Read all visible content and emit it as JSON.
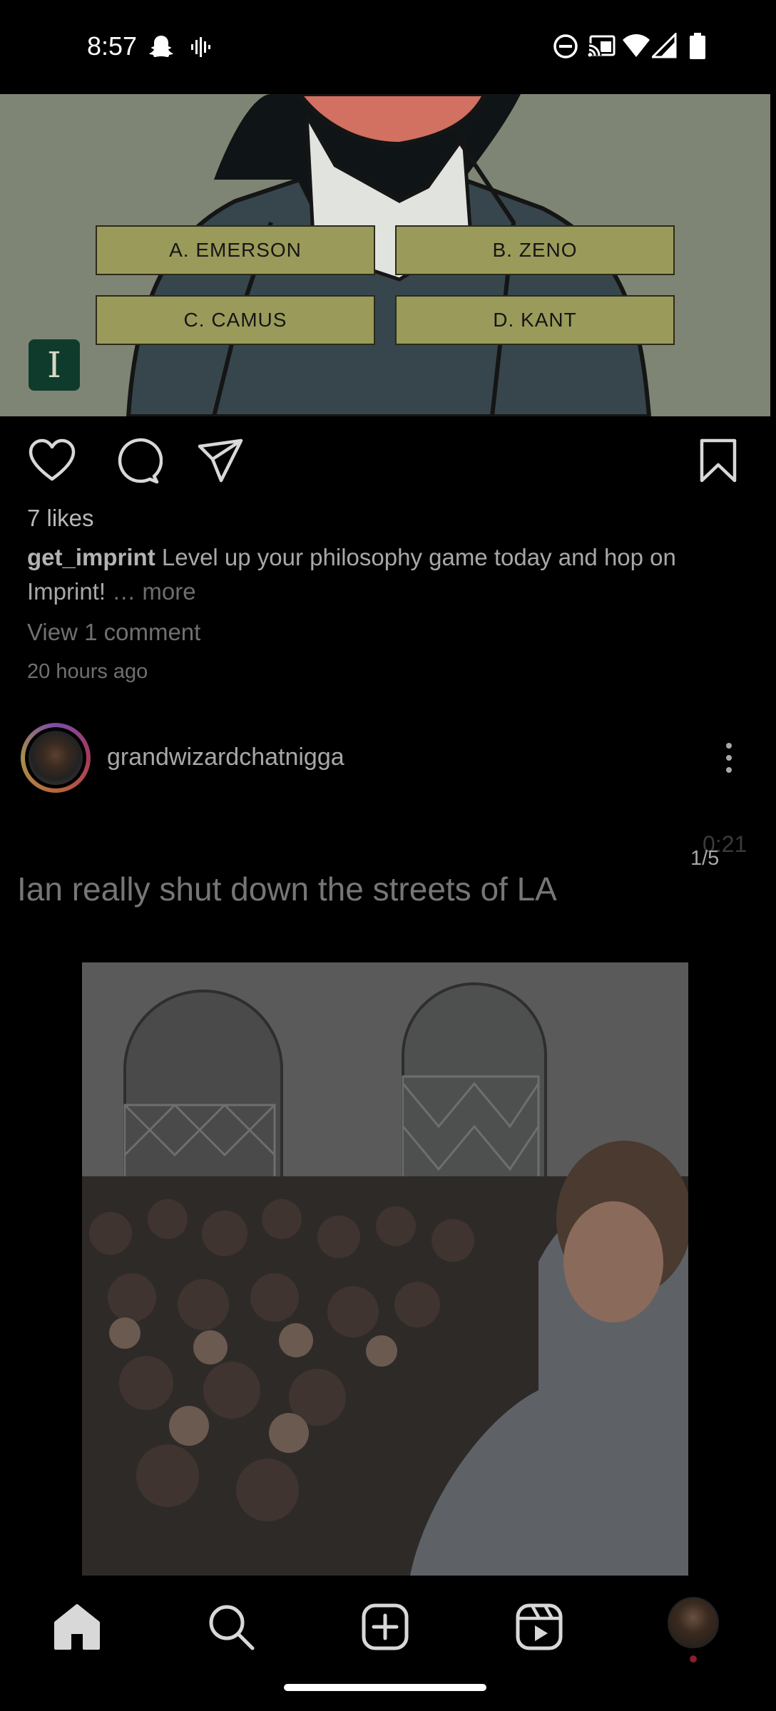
{
  "status_bar": {
    "time": "8:57"
  },
  "ad_post": {
    "answers": [
      "A. EMERSON",
      "B. ZENO",
      "C. CAMUS",
      "D. KANT"
    ],
    "logo_letter": "I",
    "likes": "7 likes",
    "username": "get_imprint",
    "caption": "Level up your philosophy game today and hop on Imprint!",
    "more_label": "… more",
    "view_comments": "View 1 comment",
    "timestamp": "20 hours ago"
  },
  "reel_post": {
    "username": "grandwizardchatnigga",
    "video_timer": "0:21",
    "carousel_count": "1/5",
    "overlay_caption": "Ian really shut down the streets of LA"
  },
  "icons": {
    "status": [
      "snapchat-icon",
      "voice-icon",
      "dnd-icon",
      "cast-icon",
      "wifi-icon",
      "signal-icon",
      "battery-icon"
    ],
    "actions": [
      "heart-icon",
      "comment-icon",
      "share-icon",
      "bookmark-icon"
    ],
    "nav": [
      "home-icon",
      "search-icon",
      "create-icon",
      "reels-icon",
      "profile-avatar"
    ]
  },
  "colors": {
    "background": "#000000",
    "quiz_button": "#9a9b5a",
    "logo_bg": "#0f3b2c"
  }
}
